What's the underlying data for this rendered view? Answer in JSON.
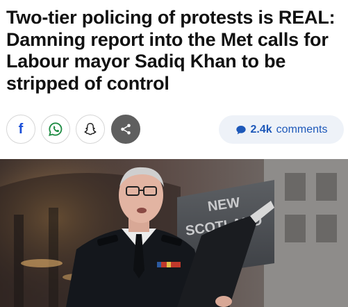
{
  "article": {
    "headline": "Two-tier policing of protests is REAL: Damning report into the Met calls for Labour mayor Sadiq Khan to be stripped of control"
  },
  "share_bar": {
    "buttons": [
      {
        "name": "facebook",
        "icon": "facebook-icon",
        "glyph": "f",
        "color": "#1b4fd8"
      },
      {
        "name": "whatsapp",
        "icon": "whatsapp-icon",
        "color": "#1e8c43"
      },
      {
        "name": "snapchat",
        "icon": "snapchat-icon",
        "color": "#222222"
      },
      {
        "name": "share",
        "icon": "share-icon",
        "color": "#ffffff"
      }
    ],
    "comments": {
      "count": "2.4k",
      "label": "comments",
      "icon": "speech-bubble-icon",
      "color": "#1d58b9"
    }
  },
  "hero_image": {
    "sign_text_line1": "NEW",
    "sign_text_line2": "SCOTLAND"
  }
}
